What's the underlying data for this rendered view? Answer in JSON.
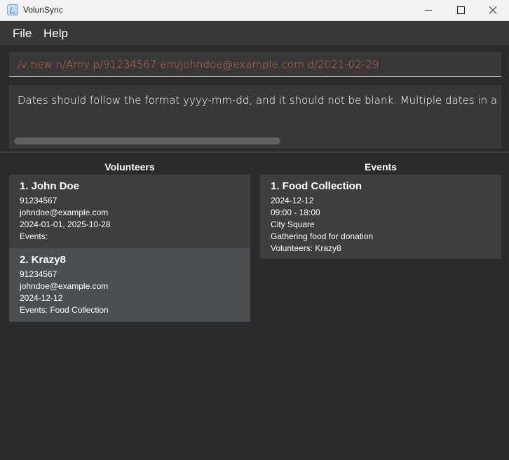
{
  "window": {
    "title": "VolunSync"
  },
  "menu": {
    "file": "File",
    "help": "Help"
  },
  "command": {
    "value": "/v new n/Amy p/91234567 em/johndoe@example.com d/2021-02-29"
  },
  "result": {
    "text": "Dates should follow the format yyyy-mm-dd, and it should not be blank. Multiple dates in a list"
  },
  "volunteers": {
    "title": "Volunteers",
    "items": [
      {
        "name": "1. John Doe",
        "phone": "91234567",
        "email": "johndoe@example.com",
        "dates": "2024-01-01, 2025-10-28",
        "events": "Events:"
      },
      {
        "name": "2. Krazy8",
        "phone": "91234567",
        "email": "johndoe@example.com",
        "dates": "2024-12-12",
        "events": "Events: Food Collection"
      }
    ]
  },
  "events": {
    "title": "Events",
    "items": [
      {
        "name": "1. Food Collection",
        "date": "2024-12-12",
        "time": "09:00 - 18:00",
        "location": "City Square",
        "description": "Gathering food for donation",
        "volunteers": "Volunteers: Krazy8"
      }
    ]
  },
  "colors": {
    "command_text": "#d06651",
    "background": "#2b2b2b",
    "selected_card": "#4a4f52"
  }
}
